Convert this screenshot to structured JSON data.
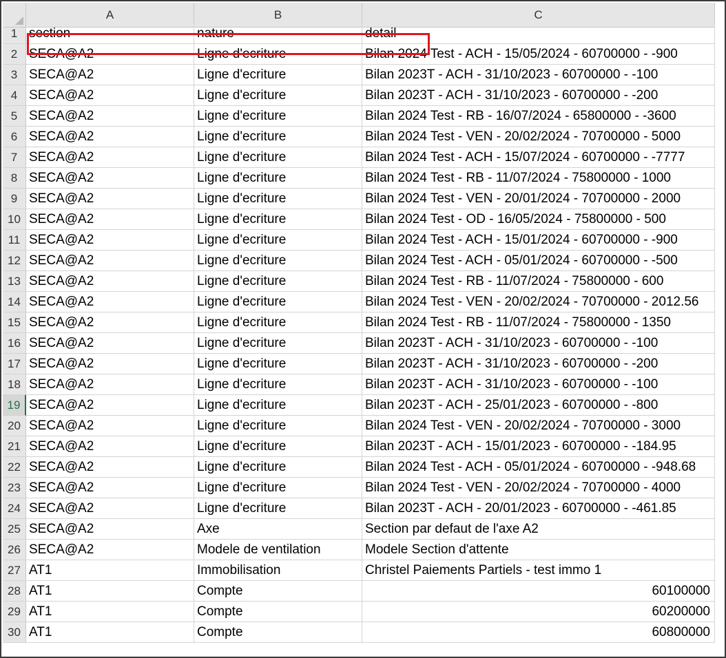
{
  "sheet": {
    "columns": [
      "A",
      "B",
      "C"
    ],
    "active_row": "19",
    "highlight_color": "#e0161f",
    "rows": [
      {
        "num": "1",
        "a": "section",
        "b": "nature",
        "c": "detail",
        "c_num": false
      },
      {
        "num": "2",
        "a": "SECA@A2",
        "b": "Ligne d'ecriture",
        "c": "Bilan 2024 Test - ACH - 15/05/2024 - 60700000 - -900",
        "c_num": false
      },
      {
        "num": "3",
        "a": "SECA@A2",
        "b": "Ligne d'ecriture",
        "c": "Bilan 2023T - ACH - 31/10/2023 - 60700000 - -100",
        "c_num": false
      },
      {
        "num": "4",
        "a": "SECA@A2",
        "b": "Ligne d'ecriture",
        "c": "Bilan 2023T - ACH - 31/10/2023 - 60700000 - -200",
        "c_num": false
      },
      {
        "num": "5",
        "a": "SECA@A2",
        "b": "Ligne d'ecriture",
        "c": "Bilan 2024 Test - RB - 16/07/2024 - 65800000 - -3600",
        "c_num": false
      },
      {
        "num": "6",
        "a": "SECA@A2",
        "b": "Ligne d'ecriture",
        "c": "Bilan 2024 Test - VEN - 20/02/2024 - 70700000 - 5000",
        "c_num": false
      },
      {
        "num": "7",
        "a": "SECA@A2",
        "b": "Ligne d'ecriture",
        "c": "Bilan 2024 Test - ACH - 15/07/2024 - 60700000 - -7777",
        "c_num": false
      },
      {
        "num": "8",
        "a": "SECA@A2",
        "b": "Ligne d'ecriture",
        "c": "Bilan 2024 Test - RB - 11/07/2024 - 75800000 - 1000",
        "c_num": false
      },
      {
        "num": "9",
        "a": "SECA@A2",
        "b": "Ligne d'ecriture",
        "c": "Bilan 2024 Test - VEN - 20/01/2024 - 70700000 - 2000",
        "c_num": false
      },
      {
        "num": "10",
        "a": "SECA@A2",
        "b": "Ligne d'ecriture",
        "c": "Bilan 2024 Test - OD - 16/05/2024 - 75800000 - 500",
        "c_num": false
      },
      {
        "num": "11",
        "a": "SECA@A2",
        "b": "Ligne d'ecriture",
        "c": "Bilan 2024 Test - ACH - 15/01/2024 - 60700000 - -900",
        "c_num": false
      },
      {
        "num": "12",
        "a": "SECA@A2",
        "b": "Ligne d'ecriture",
        "c": "Bilan 2024 Test - ACH - 05/01/2024 - 60700000 - -500",
        "c_num": false
      },
      {
        "num": "13",
        "a": "SECA@A2",
        "b": "Ligne d'ecriture",
        "c": "Bilan 2024 Test - RB - 11/07/2024 - 75800000 - 600",
        "c_num": false
      },
      {
        "num": "14",
        "a": "SECA@A2",
        "b": "Ligne d'ecriture",
        "c": "Bilan 2024 Test - VEN - 20/02/2024 - 70700000 - 2012.56",
        "c_num": false
      },
      {
        "num": "15",
        "a": "SECA@A2",
        "b": "Ligne d'ecriture",
        "c": "Bilan 2024 Test - RB - 11/07/2024 - 75800000 - 1350",
        "c_num": false
      },
      {
        "num": "16",
        "a": "SECA@A2",
        "b": "Ligne d'ecriture",
        "c": "Bilan 2023T - ACH - 31/10/2023 - 60700000 - -100",
        "c_num": false
      },
      {
        "num": "17",
        "a": "SECA@A2",
        "b": "Ligne d'ecriture",
        "c": "Bilan 2023T - ACH - 31/10/2023 - 60700000 - -200",
        "c_num": false
      },
      {
        "num": "18",
        "a": "SECA@A2",
        "b": "Ligne d'ecriture",
        "c": "Bilan 2023T - ACH - 31/10/2023 - 60700000 - -100",
        "c_num": false
      },
      {
        "num": "19",
        "a": "SECA@A2",
        "b": "Ligne d'ecriture",
        "c": "Bilan 2023T - ACH - 25/01/2023 - 60700000 - -800",
        "c_num": false
      },
      {
        "num": "20",
        "a": "SECA@A2",
        "b": "Ligne d'ecriture",
        "c": "Bilan 2024 Test - VEN - 20/02/2024 - 70700000 - 3000",
        "c_num": false
      },
      {
        "num": "21",
        "a": "SECA@A2",
        "b": "Ligne d'ecriture",
        "c": "Bilan 2023T - ACH - 15/01/2023 - 60700000 - -184.95",
        "c_num": false
      },
      {
        "num": "22",
        "a": "SECA@A2",
        "b": "Ligne d'ecriture",
        "c": "Bilan 2024 Test - ACH - 05/01/2024 - 60700000 - -948.68",
        "c_num": false
      },
      {
        "num": "23",
        "a": "SECA@A2",
        "b": "Ligne d'ecriture",
        "c": "Bilan 2024 Test - VEN - 20/02/2024 - 70700000 - 4000",
        "c_num": false
      },
      {
        "num": "24",
        "a": "SECA@A2",
        "b": "Ligne d'ecriture",
        "c": "Bilan 2023T - ACH - 20/01/2023 - 60700000 - -461.85",
        "c_num": false
      },
      {
        "num": "25",
        "a": "SECA@A2",
        "b": "Axe",
        "c": "Section par defaut de l'axe A2",
        "c_num": false
      },
      {
        "num": "26",
        "a": "SECA@A2",
        "b": "Modele de ventilation",
        "c": "Modele Section d'attente",
        "c_num": false
      },
      {
        "num": "27",
        "a": "AT1",
        "b": "Immobilisation",
        "c": "Christel Paiements Partiels - test immo 1",
        "c_num": false
      },
      {
        "num": "28",
        "a": "AT1",
        "b": "Compte",
        "c": "60100000",
        "c_num": true
      },
      {
        "num": "29",
        "a": "AT1",
        "b": "Compte",
        "c": "60200000",
        "c_num": true
      },
      {
        "num": "30",
        "a": "AT1",
        "b": "Compte",
        "c": "60800000",
        "c_num": true
      }
    ]
  }
}
